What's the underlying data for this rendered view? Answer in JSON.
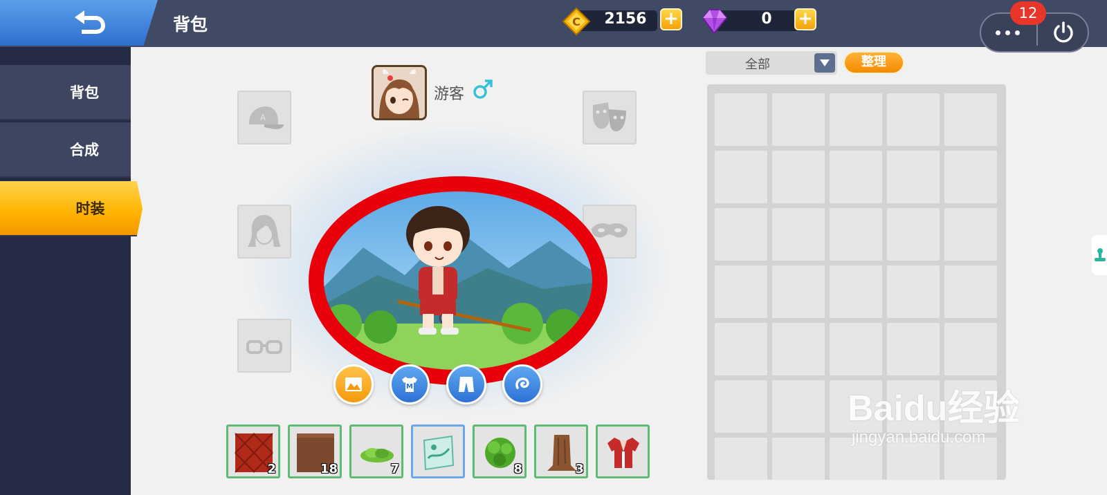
{
  "header": {
    "title": "背包",
    "gold": {
      "value": "2156",
      "icon": "gold-coin-icon"
    },
    "gems": {
      "value": "0",
      "icon": "purple-gem-icon"
    },
    "notification_count": "12",
    "accent": "#ffb300"
  },
  "sidebar": {
    "items": [
      {
        "label": "背包",
        "active": false
      },
      {
        "label": "合成",
        "active": false
      },
      {
        "label": "时装",
        "active": true
      }
    ]
  },
  "character": {
    "name": "游客",
    "gender": "male",
    "highlight_color": "#e8000a"
  },
  "inventory_bar": [
    {
      "name": "red-brick-block",
      "count": "2"
    },
    {
      "name": "dirt-block",
      "count": "18"
    },
    {
      "name": "grass-bush",
      "count": "7"
    },
    {
      "name": "map-scroll",
      "count": ""
    },
    {
      "name": "leaf-block",
      "count": "8"
    },
    {
      "name": "tree-trunk",
      "count": "3"
    },
    {
      "name": "red-jacket",
      "count": ""
    }
  ],
  "inventory_panel": {
    "filter": "全部",
    "sort_label": "整理",
    "rows": 7,
    "cols": 5
  },
  "watermark": {
    "main": "Baidu经验",
    "sub": "jingyan.baidu.com"
  }
}
